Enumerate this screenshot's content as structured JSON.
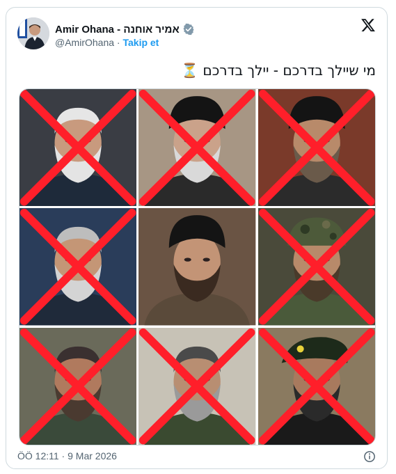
{
  "tweet": {
    "author_name": "Amir Ohana - אמיר אוחנה",
    "handle": "@AmirOhana",
    "separator": "·",
    "follow_label": "Takip et",
    "text": "מי שיילך בדרכם - יילך בדרכם ⏳",
    "timestamp": "ÖÖ 12:11 · 9 Mar 2026"
  },
  "photo_grid": {
    "photos": [
      {
        "crossed_out": true,
        "headwear": "none",
        "hair": "#e6e6e6",
        "beard": "#e4e4e4",
        "skin": "#c89a7e",
        "bg": "#3a3d44",
        "clothing": "#1e2a3a"
      },
      {
        "crossed_out": true,
        "headwear": "turban",
        "hair": "#1a1a1a",
        "beard": "#d9d9d9",
        "skin": "#caa28a",
        "bg": "#a79684",
        "clothing": "#2a2a2a"
      },
      {
        "crossed_out": true,
        "headwear": "turban",
        "hair": "#1a1a1a",
        "beard": "#6a5a4a",
        "skin": "#b88a6a",
        "bg": "#7a3a2a",
        "clothing": "#2b2b2b"
      },
      {
        "crossed_out": true,
        "headwear": "none",
        "hair": "#bdbdbd",
        "beard": "#d4d4d4",
        "skin": "#c49676",
        "bg": "#2a3d5a",
        "clothing": "#1f2a3a"
      },
      {
        "crossed_out": false,
        "headwear": "turban",
        "hair": "#1a1a1a",
        "beard": "#3a2a20",
        "skin": "#c39476",
        "bg": "#6a5444",
        "clothing": "#5a4a3a"
      },
      {
        "crossed_out": true,
        "headwear": "camo",
        "hair": "#3a3a2a",
        "beard": "#4a3a2a",
        "skin": "#b88a6a",
        "bg": "#4a4a3a",
        "clothing": "#4a5a3a"
      },
      {
        "crossed_out": true,
        "headwear": "none",
        "hair": "#3a3030",
        "beard": "#4a3a30",
        "skin": "#b07a5e",
        "bg": "#6a6a5a",
        "clothing": "#3a4a3a"
      },
      {
        "crossed_out": true,
        "headwear": "none",
        "hair": "#4a4a4a",
        "beard": "#9a9a9a",
        "skin": "#b88e72",
        "bg": "#c7c2b6",
        "clothing": "#3a4a30"
      },
      {
        "crossed_out": true,
        "headwear": "beret",
        "hair": "#1a1a1a",
        "beard": "#2a2a2a",
        "skin": "#a87a5e",
        "bg": "#8a7a60",
        "clothing": "#1a1a1a"
      }
    ]
  },
  "colors": {
    "follow": "#1d9bf0",
    "verified": "#829aab",
    "cross": "#ff1f2a",
    "secondary_text": "#536471"
  },
  "icons": {
    "x_logo": "x-logo-icon",
    "verified": "verified-badge-icon",
    "info": "info-icon"
  }
}
